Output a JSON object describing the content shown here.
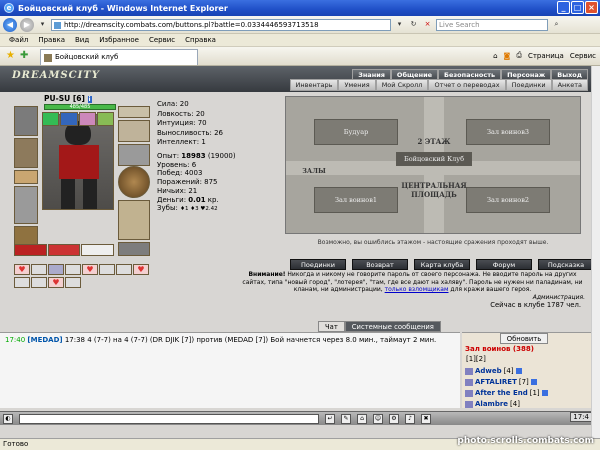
{
  "window": {
    "title": "Бойцовский клуб - Windows Internet Explorer"
  },
  "address": {
    "url": "http://dreamscity.combats.com/buttons.pl?battle=0.0334446593713518",
    "search_placeholder": "Live Search"
  },
  "menu": [
    "Файл",
    "Правка",
    "Вид",
    "Избранное",
    "Сервис",
    "Справка"
  ],
  "tab": {
    "label": "Бойцовский клуб"
  },
  "tools": {
    "page": "Страница",
    "service": "Сервис"
  },
  "logo": "DREAMSCITY",
  "nav_top": [
    "Знания",
    "Общение",
    "Безопасность",
    "Персонаж",
    "Выход"
  ],
  "nav_sub": [
    "Инвентарь",
    "Умения",
    "Мой Скролл",
    "Отчет о переводах",
    "Поединки",
    "Анкета"
  ],
  "character": {
    "name": "PU-SU",
    "level": "[6]",
    "hp": "485/485",
    "stats": [
      "Сила: 20",
      "Ловкость: 20",
      "Интуиция: 70",
      "Выносливость: 26",
      "Интеллект: 1"
    ],
    "stats2": [
      "Опыт: ",
      "Уровень: 6",
      "Побед: 4003",
      "Поражений: 875",
      "Ничьих: 21",
      "Деньги: ",
      "Зубы: "
    ],
    "exp": "18983",
    "exp_next": "(19000)",
    "money": "0.01",
    "money_unit": " кр.",
    "teeth": "♦1 ♦3 ♥2.42"
  },
  "map": {
    "rooms": [
      "Будуар",
      "Зал воинов3",
      "Зал воинов1",
      "Зал воинов2",
      "Бойцовский Клуб",
      "ЗАЛЫ"
    ],
    "floor": "2 ЭТАЖ",
    "central": "ЦЕНТРАЛЬНАЯ ПЛОЩАДЬ",
    "message": "Возможно, вы ошиблись этажом - настоящие сражения проходят выше."
  },
  "buttons": [
    "Поединки",
    "Возврат",
    "Карта клуба",
    "Форум",
    "Подсказка"
  ],
  "warning": {
    "label": "Внимание!",
    "text1": " Никогда и никому не говорите пароль от своего персонажа. Не вводите пароль на других сайтах, типа \"новый город\", \"лотерея\", \"там, где все дают на халяву\". Пароль не нужен ни паладинам, ни кланам, ни администрации, ",
    "link": "только взломщикам",
    "text2": " для кражи вашего героя.",
    "sign": "Администрация."
  },
  "online": "Сейчас в клубе 1787 чел.",
  "chat_tabs": [
    "Чат",
    "Системные сообщения"
  ],
  "chat": {
    "time": "17:40",
    "name": "[MEDAD]",
    "text": " 17:38 4 (7-7) на 4 (7-7) (DR DJIK [7]) против (MEDAD [7]) Бой начнется через 8.0 мин., таймаут 2 мин."
  },
  "side": {
    "refresh": "Обновить",
    "room": "Зал воинов (388)",
    "pages": "[1][2]",
    "players": [
      {
        "name": "Adweb",
        "level": "[4]"
      },
      {
        "name": "AFTALIRET",
        "level": "[7]"
      },
      {
        "name": "After the End",
        "level": "[1]"
      },
      {
        "name": "Alambre",
        "level": "[4]"
      }
    ]
  },
  "clock": "17:4",
  "status": "Готово",
  "watermark": "photo.scrolls.combats.com"
}
